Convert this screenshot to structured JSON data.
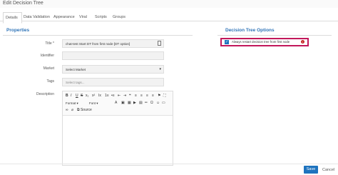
{
  "window": {
    "title": "Edit Decision Tree"
  },
  "tabs": [
    {
      "label": "Details"
    },
    {
      "label": "Data Validation"
    },
    {
      "label": "Appearance"
    },
    {
      "label": "Viral"
    },
    {
      "label": "Scripts"
    },
    {
      "label": "Groups"
    }
  ],
  "properties": {
    "heading": "Properties",
    "fields": {
      "title": {
        "label": "Title *",
        "value": "chat-test Start DT from first node [DT option]"
      },
      "identifier": {
        "label": "Identifier",
        "value": ""
      },
      "market": {
        "label": "Market",
        "value": "Select Market"
      },
      "tags": {
        "label": "Tags",
        "placeholder": "Select tags..."
      },
      "description": {
        "label": "Description"
      }
    }
  },
  "editor": {
    "row1": [
      "B",
      "I",
      "U",
      "S",
      "x₂",
      "x²",
      "Ix",
      "1≡",
      "•≡",
      "⇤",
      "⇥",
      "❝",
      "≡",
      "≡",
      "≡",
      "≡",
      "⚑",
      "⛶"
    ],
    "format_label": "Format",
    "font_label": "Font",
    "source_label": "Source"
  },
  "options": {
    "heading": "Decision Tree Options",
    "always_restart_label": "Always restart decision tree from first node",
    "always_restart_checked": true
  },
  "footer": {
    "save_label": "Save",
    "cancel_label": "Cancel"
  },
  "colors": {
    "accent": "#2f74b8",
    "save_button": "#1e73be",
    "highlight_border": "#c2185b"
  }
}
